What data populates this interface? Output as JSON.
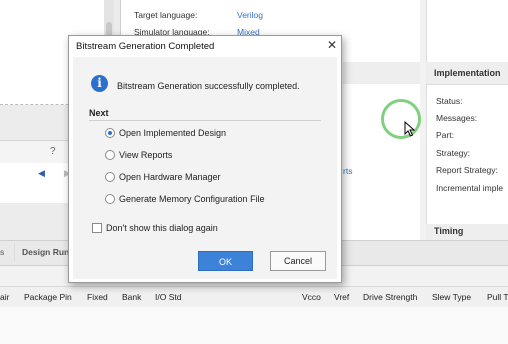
{
  "background": {
    "left_toolbar": {
      "help_glyph": "?",
      "back_arrow": "◀",
      "forward_arrow": "▶"
    },
    "project_settings": [
      {
        "label": "Target language:",
        "value": "Verilog"
      },
      {
        "label": "Simulator language:",
        "value": "Mixed"
      }
    ],
    "implementation": {
      "header": "Implementation",
      "rows": [
        "Status:",
        "Messages:",
        "Part:",
        "Strategy:",
        "Report Strategy:",
        "Incremental imple"
      ]
    },
    "timing_header": "Timing",
    "reports_link_fragment": "rts",
    "bottom_tabs": [
      "s",
      "Design Runs"
    ],
    "table_columns": [
      "air",
      "Package Pin",
      "Fixed",
      "Bank",
      "I/O Std",
      "Vcco",
      "Vref",
      "Drive Strength",
      "Slew Type",
      "Pull T"
    ]
  },
  "dialog": {
    "title": "Bitstream Generation Completed",
    "close_glyph": "✕",
    "message": "Bitstream Generation successfully completed.",
    "info_glyph": "i",
    "next_heading": "Next",
    "options": [
      {
        "label": "Open Implemented Design",
        "selected": true
      },
      {
        "label": "View Reports",
        "selected": false
      },
      {
        "label": "Open Hardware Manager",
        "selected": false
      },
      {
        "label": "Generate Memory Configuration File",
        "selected": false
      }
    ],
    "dont_show_label": "Don't show this dialog again",
    "dont_show_checked": false,
    "ok_label": "OK",
    "cancel_label": "Cancel"
  },
  "colors": {
    "accent": "#3d82d9",
    "link": "#3a6fc4",
    "cursor_highlight": "#7fd07f"
  },
  "icons": {
    "info": "info-icon",
    "close": "close-icon",
    "cursor": "mouse-cursor-icon"
  }
}
